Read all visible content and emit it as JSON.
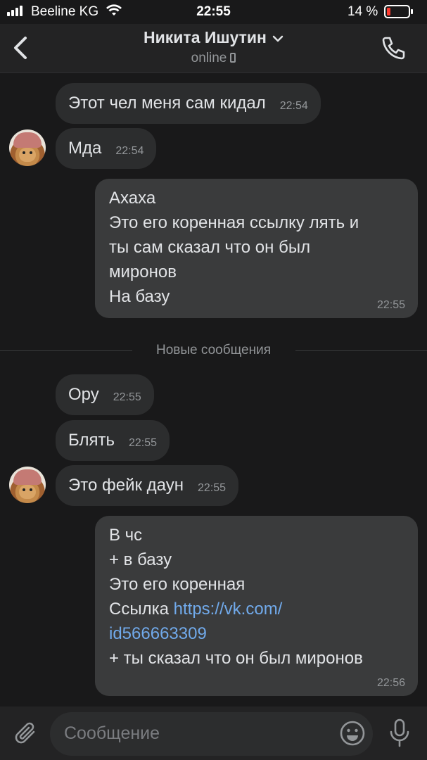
{
  "status_bar": {
    "carrier": "Beeline KG",
    "time": "22:55",
    "battery": "14 %"
  },
  "header": {
    "contact_name": "Никита Ишутин",
    "status": "online"
  },
  "messages": [
    {
      "direction": "in",
      "text": "Этот чел меня сам кидал",
      "time": "22:54"
    },
    {
      "direction": "in",
      "text": "Мда",
      "time": "22:54"
    },
    {
      "direction": "out",
      "lines": [
        "Ахаха",
        "Это его коренная ссылку лять и",
        "ты сам сказал что он был",
        "миронов",
        "На базу"
      ],
      "time": "22:55"
    },
    {
      "direction": "in",
      "text": "Ору",
      "time": "22:55"
    },
    {
      "direction": "in",
      "text": "Блять",
      "time": "22:55"
    },
    {
      "direction": "in",
      "text": "Это фейк даун",
      "time": "22:55"
    },
    {
      "direction": "out",
      "lines": [
        "В чс",
        "+ в базу",
        "Это его коренная",
        "Ссылка",
        "https://vk.com/",
        "id566663309",
        "+ ты сказал что он был миронов"
      ],
      "time": "22:56"
    }
  ],
  "divider_label": "Новые сообщения",
  "composer": {
    "placeholder": "Сообщение"
  },
  "colors": {
    "background": "#19191a",
    "bubble_in": "#2c2d2e",
    "bubble_out": "#3a3b3c",
    "link": "#71aaeb"
  }
}
